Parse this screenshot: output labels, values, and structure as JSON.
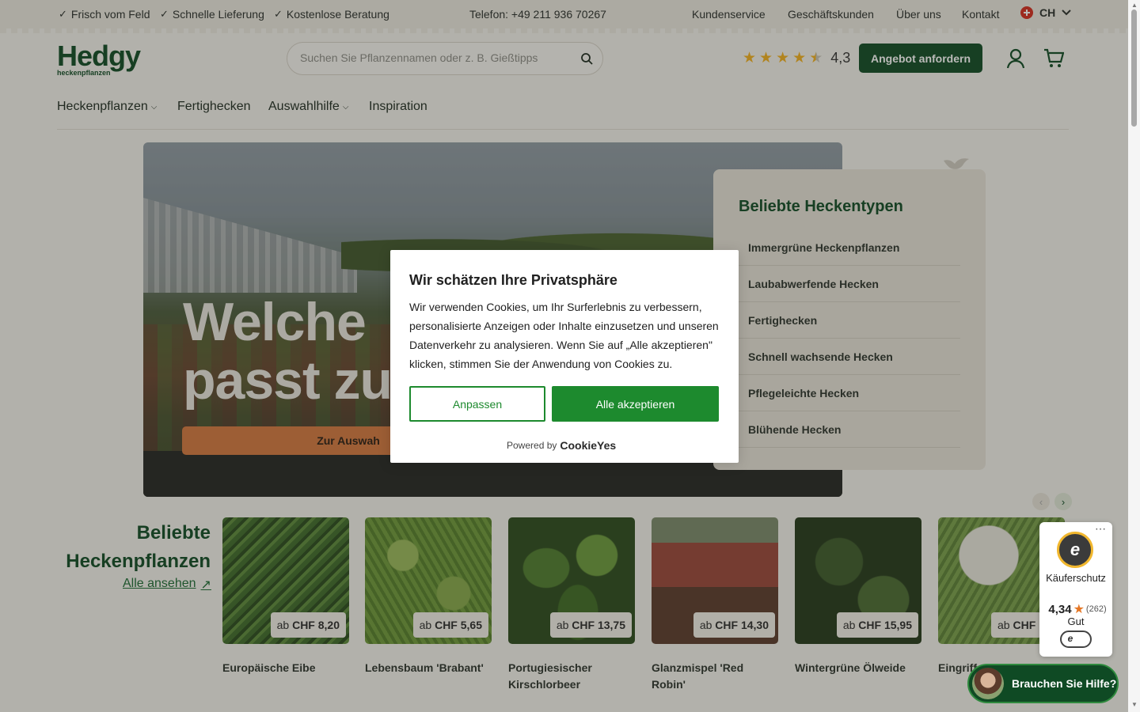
{
  "topbar": {
    "usps": [
      "Frisch vom Feld",
      "Schnelle Lieferung",
      "Kostenlose Beratung"
    ],
    "phone": "Telefon: +49 211 936 70267",
    "links": [
      "Kundenservice",
      "Geschäftskunden",
      "Über uns",
      "Kontakt"
    ],
    "country": "CH"
  },
  "header": {
    "brand": "Hedgy",
    "brand_sub": "heckenpflanzen",
    "search_placeholder": "Suchen Sie Pflanzennamen oder z. B. Gießtipps",
    "rating_value": "4,3",
    "rating_stars": 4.3,
    "quote_button": "Angebot anfordern"
  },
  "nav": {
    "items": [
      "Heckenpflanzen",
      "Fertighecken",
      "Auswahlhilfe",
      "Inspiration"
    ]
  },
  "hero": {
    "line1": "Welche",
    "line2": "passt zu",
    "cta": "Zur Auswah"
  },
  "hedge_types": {
    "title": "Beliebte Heckentypen",
    "items": [
      "Immergrüne Heckenpflanzen",
      "Laubabwerfende Hecken",
      "Fertighecken",
      "Schnell wachsende Hecken",
      "Pflegeleichte Hecken",
      "Blühende Hecken"
    ]
  },
  "cookie": {
    "title": "Wir schätzen Ihre Privatsphäre",
    "body": "Wir verwenden Cookies, um Ihr Surferlebnis zu verbessern, personalisierte Anzeigen oder Inhalte einzusetzen und unseren Datenverkehr zu analysieren. Wenn Sie auf „Alle akzeptieren\" klicken, stimmen Sie der Anwendung von Cookies zu.",
    "customize": "Anpassen",
    "accept": "Alle akzeptieren",
    "powered_by": "Powered by",
    "brand": "CookieYes"
  },
  "products": {
    "title_line1": "Beliebte",
    "title_line2": "Heckenpflanzen",
    "see_all": "Alle ansehen",
    "price_prefix": "ab",
    "items": [
      {
        "name": "Europäische Eibe",
        "price": "CHF 8,20"
      },
      {
        "name": "Lebensbaum 'Brabant'",
        "price": "CHF 5,65"
      },
      {
        "name": "Portugiesischer Kirschlorbeer",
        "price": "CHF 13,75"
      },
      {
        "name": "Glanzmispel 'Red Robin'",
        "price": "CHF 14,30"
      },
      {
        "name": "Wintergrüne Ölweide",
        "price": "CHF 15,95"
      },
      {
        "name": "Eingriff",
        "price": "CHF"
      }
    ]
  },
  "trust": {
    "label": "Käuferschutz",
    "score": "4,34",
    "count": "(262)",
    "grade": "Gut"
  },
  "help": {
    "label": "Brauchen Sie Hilfe?"
  },
  "colors": {
    "brand_green": "#0f4a24",
    "accept_green": "#1d8a2e",
    "cta_orange": "#d5783f",
    "star": "#f2b01e"
  }
}
